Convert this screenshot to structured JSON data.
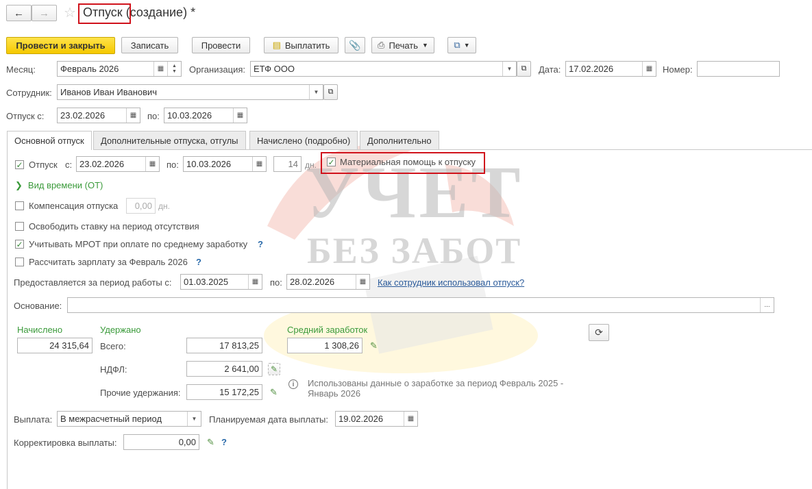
{
  "window": {
    "title_doc": "Отпуск",
    "title_rest": "(создание) *",
    "nav_back_icon": "arrow-left-icon",
    "nav_forward_icon": "arrow-right-icon",
    "favorite_icon": "star-icon"
  },
  "toolbar": {
    "post_and_close": "Провести и закрыть",
    "save": "Записать",
    "post": "Провести",
    "pay": "Выплатить",
    "print": "Печать"
  },
  "header": {
    "month_label": "Месяц:",
    "month_value": "Февраль 2026",
    "org_label": "Организация:",
    "org_value": "ЕТФ ООО",
    "date_label": "Дата:",
    "date_value": "17.02.2026",
    "number_label": "Номер:",
    "number_value": "",
    "employee_label": "Сотрудник:",
    "employee_value": "Иванов Иван Иванович",
    "leave_from_label": "Отпуск с:",
    "leave_from_value": "23.02.2026",
    "leave_to_label": "по:",
    "leave_to_value": "10.03.2026"
  },
  "tabs": [
    {
      "label": "Основной отпуск"
    },
    {
      "label": "Дополнительные отпуска, отгулы"
    },
    {
      "label": "Начислено (подробно)"
    },
    {
      "label": "Дополнительно"
    }
  ],
  "main": {
    "vacation_label": "Отпуск",
    "vacation_from_label": "с:",
    "vacation_from": "23.02.2026",
    "vacation_to_label": "по:",
    "vacation_to": "10.03.2026",
    "days": "14",
    "days_unit": "дн.",
    "material_aid_label": "Материальная помощь к отпуску",
    "time_type_link": "Вид времени (ОТ)",
    "compensation_label": "Компенсация отпуска",
    "compensation_days": "0,00",
    "compensation_unit": "дн.",
    "free_rate_label": "Освободить ставку на период отсутствия",
    "mrot_label": "Учитывать МРОТ при оплате по среднему заработку",
    "calc_salary_label": "Рассчитать зарплату за Февраль 2026",
    "period_label": "Предоставляется за период работы с:",
    "period_from": "01.03.2025",
    "period_to_label": "по:",
    "period_to": "28.02.2026",
    "usage_link": "Как сотрудник использовал отпуск?",
    "basis_label": "Основание:",
    "basis_value": "",
    "accrued_title": "Начислено",
    "accrued_value": "24 315,64",
    "withheld_title": "Удержано",
    "total_label": "Всего:",
    "total_value": "17 813,25",
    "ndfl_label": "НДФЛ:",
    "ndfl_value": "2 641,00",
    "other_label": "Прочие удержания:",
    "other_value": "15 172,25",
    "avg_title": "Средний заработок",
    "avg_value": "1 308,26",
    "info_text_1": "Использованы данные о заработке за период Февраль 2025 -",
    "info_text_2": "Январь 2026",
    "payout_label": "Выплата:",
    "payout_value": "В межрасчетный период",
    "planned_date_label": "Планируемая дата выплаты:",
    "planned_date_value": "19.02.2026",
    "correction_label": "Корректировка выплаты:",
    "correction_value": "0,00",
    "help_mark": "?"
  },
  "watermark": {
    "line1": "УЧЕТ",
    "line2": "БЕЗ ЗАБОТ"
  },
  "colors": {
    "primary_button": "#f5c800",
    "green_accent": "#3a9a3a",
    "link": "#2a5a9a",
    "highlight_box": "#d0121b"
  }
}
